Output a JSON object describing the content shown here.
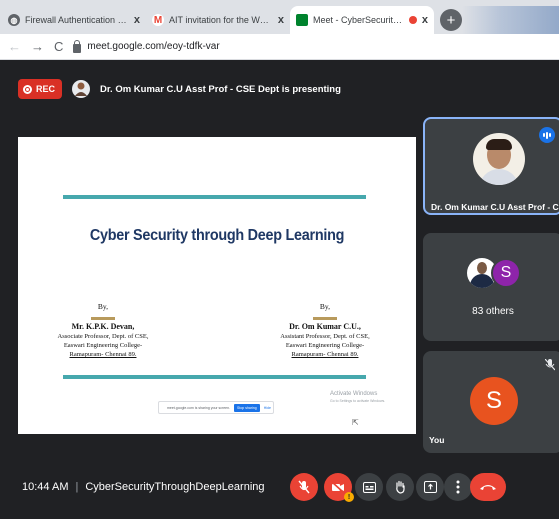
{
  "browser": {
    "tabs": [
      {
        "title": "Firewall Authentication Keepalive",
        "favicon_color": "#5f6368",
        "active": false
      },
      {
        "title": "AIT invitation for the Workshop on",
        "favicon_color": "#ea4335",
        "active": false
      },
      {
        "title": "Meet - CyberSecurityThroughDeepLearning",
        "favicon_color": "#f9ab00",
        "active": true
      }
    ],
    "new_tab_symbol": "+",
    "close_symbol": "x",
    "url": "meet.google.com/eoy-tdfk-var",
    "back_icon": "←",
    "forward_icon": "→",
    "reload_icon": "C"
  },
  "meet": {
    "rec_label": "REC",
    "presenting_text": "Dr. Om Kumar C.U Asst Prof - CSE Dept is presenting",
    "slide": {
      "title": "Cyber Security through Deep Learning",
      "by_label": "By,",
      "author1": {
        "name": "Mr. K.P.K. Devan,",
        "lines": [
          "Associate Professor, Dept. of CSE,",
          "Easwari Engineering College-",
          "Ramapuram- Chennai 89."
        ]
      },
      "author2": {
        "name": "Dr. Om Kumar  C.U.,",
        "lines": [
          "Assistant Professor, Dept. of CSE,",
          "Easwari Engineering College-",
          "Ramapuram- Chennai 89."
        ]
      },
      "share_text": "meet.google.com is sharing your screen.",
      "stop_sharing": "Stop sharing",
      "hide": "Hide",
      "watermark_title": "Activate Windows",
      "watermark_sub": "Go to Settings to activate Windows."
    },
    "tiles": [
      {
        "name": "Dr. Om Kumar C.U Asst Prof - CS..."
      },
      {
        "avatar_letter": "S",
        "others_label": "83 others"
      },
      {
        "avatar_letter": "S",
        "name": "You"
      }
    ],
    "bottom": {
      "time": "10:44 AM",
      "separator": "|",
      "meeting_name": "CyberSecurityThroughDeepLearning"
    }
  }
}
